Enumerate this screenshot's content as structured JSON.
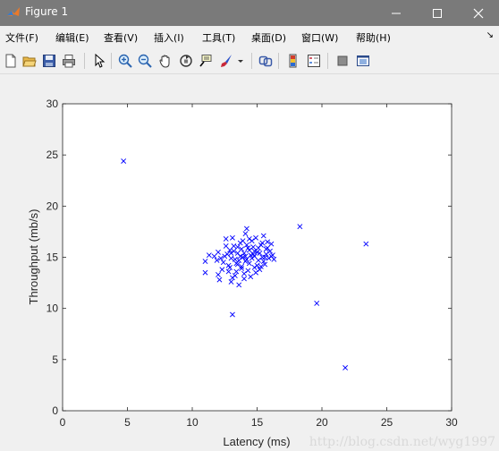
{
  "window": {
    "title": "Figure 1",
    "icons": [
      "matlab-icon",
      "minimize-icon",
      "maximize-icon",
      "close-icon"
    ]
  },
  "menu": {
    "items": [
      {
        "label": "文件(F)"
      },
      {
        "label": "编辑(E)"
      },
      {
        "label": "查看(V)"
      },
      {
        "label": "插入(I)"
      },
      {
        "label": "工具(T)"
      },
      {
        "label": "桌面(D)"
      },
      {
        "label": "窗口(W)"
      },
      {
        "label": "帮助(H)"
      }
    ],
    "overflow": "↘"
  },
  "toolbar": {
    "icons": [
      "new-figure-icon",
      "open-file-icon",
      "save-icon",
      "print-icon",
      "pointer-icon",
      "zoom-in-icon",
      "zoom-out-icon",
      "pan-hand-icon",
      "rotate-3d-icon",
      "data-cursor-icon",
      "brush-icon",
      "brush-dropdown-icon",
      "link-plot-icon",
      "colorbar-icon",
      "legend-icon",
      "hide-plot-tools-icon",
      "show-plot-tools-icon"
    ]
  },
  "chart_data": {
    "type": "scatter",
    "xlabel": "Latency (ms)",
    "ylabel": "Throughput (mb/s)",
    "xlim": [
      0,
      30
    ],
    "ylim": [
      0,
      30
    ],
    "xticks": [
      "0",
      "5",
      "10",
      "15",
      "20",
      "25",
      "30"
    ],
    "yticks": [
      "0",
      "5",
      "10",
      "15",
      "20",
      "25",
      "30"
    ],
    "marker": "x",
    "color": "#0000ff",
    "grid": false,
    "points": [
      [
        4.7,
        24.4
      ],
      [
        18.3,
        18.0
      ],
      [
        23.4,
        16.3
      ],
      [
        19.6,
        10.5
      ],
      [
        21.8,
        4.2
      ],
      [
        13.1,
        9.4
      ],
      [
        11.0,
        13.5
      ],
      [
        11.0,
        14.6
      ],
      [
        11.3,
        15.2
      ],
      [
        11.9,
        14.7
      ],
      [
        12.0,
        13.3
      ],
      [
        12.1,
        12.8
      ],
      [
        12.3,
        13.8
      ],
      [
        12.5,
        15.1
      ],
      [
        12.6,
        16.8
      ],
      [
        12.8,
        14.2
      ],
      [
        12.9,
        15.7
      ],
      [
        13.0,
        12.6
      ],
      [
        13.1,
        13.0
      ],
      [
        13.2,
        16.1
      ],
      [
        13.3,
        14.8
      ],
      [
        13.4,
        13.6
      ],
      [
        13.5,
        15.4
      ],
      [
        13.6,
        12.3
      ],
      [
        13.7,
        16.4
      ],
      [
        13.8,
        14.1
      ],
      [
        13.9,
        15.0
      ],
      [
        14.0,
        13.4
      ],
      [
        14.1,
        17.3
      ],
      [
        14.2,
        17.8
      ],
      [
        14.3,
        15.9
      ],
      [
        14.4,
        14.4
      ],
      [
        14.5,
        13.1
      ],
      [
        14.6,
        16.6
      ],
      [
        14.7,
        15.3
      ],
      [
        14.8,
        14.0
      ],
      [
        14.9,
        16.9
      ],
      [
        15.0,
        15.5
      ],
      [
        15.1,
        14.7
      ],
      [
        15.2,
        13.8
      ],
      [
        15.3,
        16.2
      ],
      [
        15.4,
        15.0
      ],
      [
        15.5,
        17.1
      ],
      [
        15.6,
        14.3
      ],
      [
        15.7,
        15.8
      ],
      [
        15.8,
        16.5
      ],
      [
        15.9,
        14.9
      ],
      [
        16.0,
        15.6
      ],
      [
        16.1,
        16.3
      ],
      [
        16.2,
        15.2
      ],
      [
        16.3,
        14.8
      ],
      [
        12.4,
        14.5
      ],
      [
        12.7,
        15.3
      ],
      [
        12.9,
        14.0
      ],
      [
        13.0,
        14.9
      ],
      [
        13.2,
        15.6
      ],
      [
        13.4,
        14.4
      ],
      [
        13.5,
        16.0
      ],
      [
        13.7,
        15.1
      ],
      [
        13.8,
        13.9
      ],
      [
        14.0,
        15.4
      ],
      [
        14.1,
        14.6
      ],
      [
        14.2,
        16.2
      ],
      [
        14.3,
        13.7
      ],
      [
        14.4,
        15.7
      ],
      [
        14.6,
        14.9
      ],
      [
        14.7,
        16.0
      ],
      [
        14.8,
        15.1
      ],
      [
        15.0,
        14.2
      ],
      [
        15.1,
        15.9
      ],
      [
        15.2,
        15.4
      ],
      [
        15.4,
        16.4
      ],
      [
        15.5,
        14.6
      ],
      [
        15.7,
        15.3
      ],
      [
        13.6,
        14.7
      ],
      [
        13.9,
        16.6
      ],
      [
        14.5,
        15.2
      ],
      [
        12.2,
        14.9
      ],
      [
        11.7,
        15.1
      ],
      [
        12.0,
        15.5
      ],
      [
        13.3,
        13.2
      ],
      [
        14.9,
        13.5
      ],
      [
        15.3,
        14.1
      ],
      [
        12.6,
        16.1
      ],
      [
        13.1,
        16.9
      ],
      [
        14.0,
        12.9
      ],
      [
        15.8,
        15.9
      ],
      [
        16.1,
        15.1
      ],
      [
        13.8,
        15.8
      ],
      [
        14.4,
        16.8
      ],
      [
        12.8,
        13.6
      ],
      [
        13.5,
        14.3
      ],
      [
        14.1,
        15.1
      ],
      [
        14.8,
        15.6
      ],
      [
        15.6,
        15.0
      ],
      [
        13.0,
        15.4
      ],
      [
        14.2,
        14.8
      ]
    ]
  },
  "watermark": "http://blog.csdn.net/wyg1997"
}
